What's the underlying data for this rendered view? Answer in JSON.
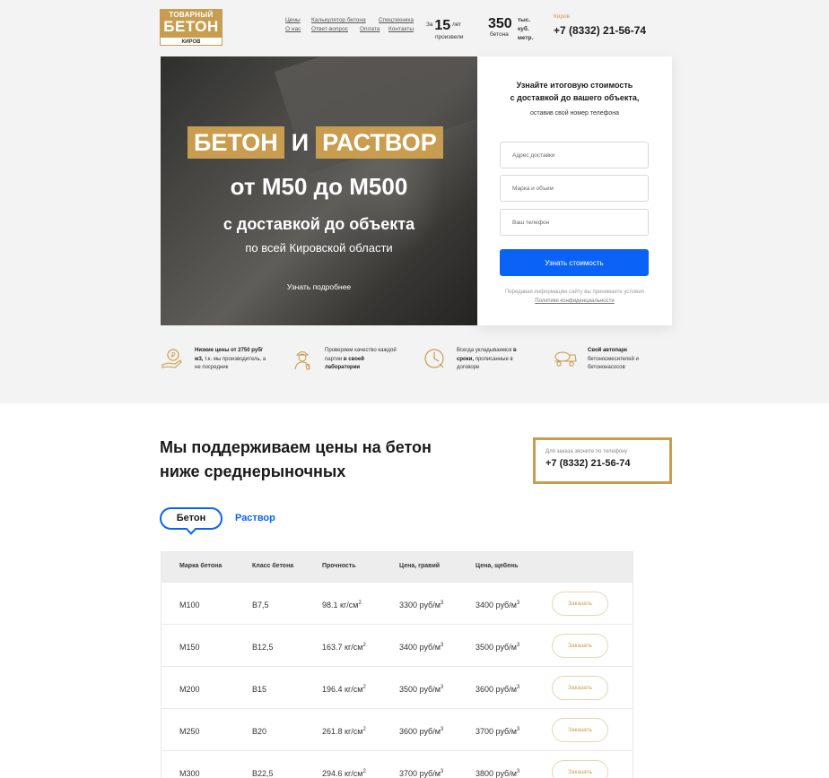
{
  "header": {
    "logo": {
      "line1": "ТОВАРНЫЙ",
      "line2": "БЕТОН",
      "line3": "КИРОВ"
    },
    "nav": [
      "Цены",
      "О нас",
      "Калькулятор бетона",
      "Ответ-вопрос",
      "Спецтехника",
      "Оплата",
      "Контакты"
    ],
    "stat_years": {
      "pre": "За",
      "num": "15",
      "unit": "лет",
      "sub": "произвели"
    },
    "stat_volume": {
      "num": "350",
      "unit1": "тыс.",
      "unit2": "куб.",
      "unit3": "метр.",
      "sub": "бетона"
    },
    "city": "Киров",
    "phone": "+7 (8332) 21-56-74"
  },
  "hero": {
    "tag1": "БЕТОН",
    "and": "И",
    "tag2": "РАСТВОР",
    "line2": "от М50 до М500",
    "line3": "с доставкой до объекта",
    "line4": "по всей Кировской области",
    "more": "Узнать подробнее"
  },
  "form": {
    "title1": "Узнайте итоговую стоимость",
    "title2": "с доставкой до вашего объекта,",
    "subtitle": "оставив свой номер телефона",
    "placeholders": {
      "address": "Адрес доставки",
      "brand": "Марка и объем",
      "phone": "Ваш телефон"
    },
    "button": "Узнать стоимость",
    "note": "Передавая информацию сайту вы принимаете условия",
    "note_link": "Политики конфиденциальности"
  },
  "features": [
    {
      "bold": "Низкие цены от 2750 руб/м3,",
      "text": " т.к. мы производитель, а не посредник",
      "icon": "money-hand-icon"
    },
    {
      "pre": "Проверяем качество каждой партии ",
      "bold": "в своей лаборатории",
      "icon": "lab-worker-icon"
    },
    {
      "pre": "Всегда укладываемся ",
      "bold": "в сроки,",
      "text": " прописанные в договоре",
      "icon": "clock-icon"
    },
    {
      "bold": "Свой автопарк",
      "text": " бетоносмесителей и бетононасосов",
      "icon": "mixer-truck-icon"
    }
  ],
  "prices": {
    "title_line1": "Мы поддерживаем цены на бетон",
    "title_line2": "ниже среднерыночных",
    "call_note": "Для заказа звоните по телефону",
    "call_phone": "+7 (8332) 21-56-74",
    "tabs": [
      "Бетон",
      "Раствор"
    ],
    "columns": [
      "Марка бетона",
      "Класс бетона",
      "Прочность",
      "Цена, гравий",
      "Цена, щебень"
    ],
    "units": {
      "strength": "кг/см",
      "price": "руб/м",
      "exp_strength": "2",
      "exp_price": "3"
    },
    "order_label": "Заказать",
    "rows": [
      {
        "brand": "М100",
        "class": "В7,5",
        "strength": "98.1",
        "gravel": "3300",
        "crushed": "3400"
      },
      {
        "brand": "М150",
        "class": "В12,5",
        "strength": "163.7",
        "gravel": "3400",
        "crushed": "3500"
      },
      {
        "brand": "М200",
        "class": "В15",
        "strength": "196.4",
        "gravel": "3500",
        "crushed": "3600"
      },
      {
        "brand": "М250",
        "class": "В20",
        "strength": "261.8",
        "gravel": "3600",
        "crushed": "3700"
      },
      {
        "brand": "М300",
        "class": "В22,5",
        "strength": "294.6",
        "gravel": "3700",
        "crushed": "3800"
      }
    ]
  },
  "colors": {
    "gold": "#c99d4f",
    "blue": "#0a63f6",
    "bg": "#f3f3f3"
  }
}
